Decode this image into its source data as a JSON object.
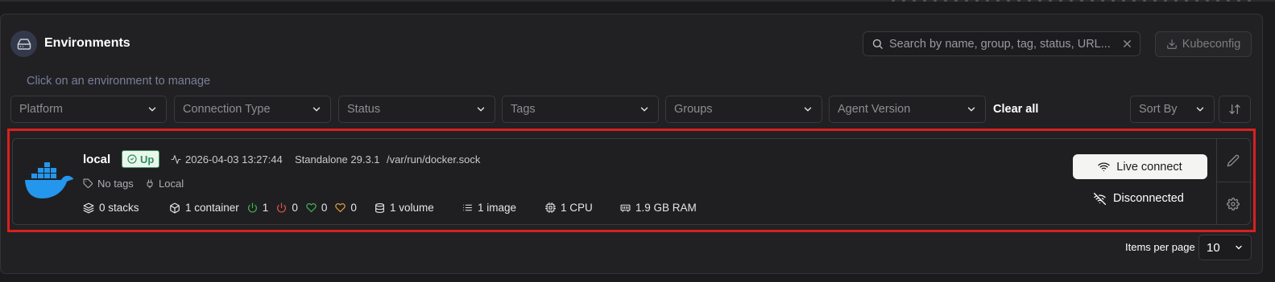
{
  "header": {
    "title": "Environments",
    "icon": "hard-drive-icon",
    "search": {
      "placeholder": "Search by name, group, tag, status, URL..."
    },
    "kubeconfig_label": "Kubeconfig"
  },
  "hint": "Click on an environment to manage",
  "filters": [
    {
      "label": "Platform"
    },
    {
      "label": "Connection Type"
    },
    {
      "label": "Status"
    },
    {
      "label": "Tags"
    },
    {
      "label": "Groups"
    },
    {
      "label": "Agent Version"
    }
  ],
  "clear_all_label": "Clear all",
  "sort": {
    "label": "Sort By"
  },
  "environment": {
    "name": "local",
    "status": "Up",
    "status_color": "#2e8f56",
    "heartbeat": "2026-04-03 13:27:44",
    "type": "Standalone 29.3.1",
    "url": "/var/run/docker.sock",
    "tags": "No tags",
    "connection": "Local",
    "stacks": "0 stacks",
    "containers": "1 container",
    "containers_running": "1",
    "containers_stopped": "0",
    "containers_healthy": "0",
    "containers_unhealthy": "0",
    "volumes": "1 volume",
    "images": "1 image",
    "cpu": "1 CPU",
    "ram": "1.9 GB RAM",
    "live_connect_label": "Live connect",
    "disconnected_label": "Disconnected"
  },
  "pagination": {
    "items_per_page_label": "Items per page",
    "items_per_page_value": "10"
  },
  "colors": {
    "accent_docker": "#2496ed",
    "highlight_border": "#d9201f",
    "running": "#3fb950",
    "stopped": "#e5534b",
    "healthy": "#3fb950",
    "unhealthy": "#e5a23b"
  }
}
